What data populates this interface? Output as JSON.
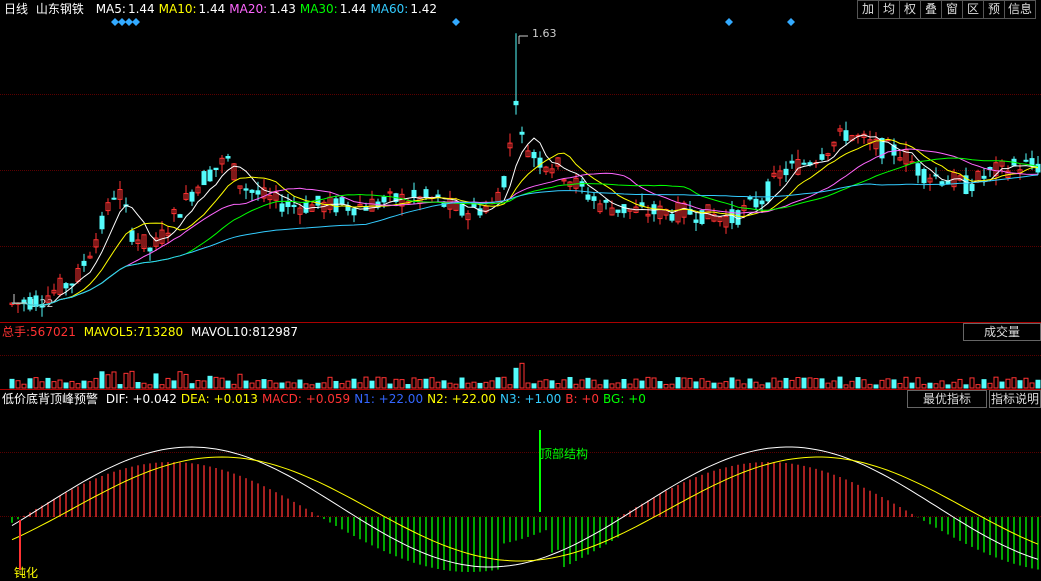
{
  "header": {
    "period": "日线",
    "stock_name": "山东钢铁",
    "ma": [
      {
        "label": "MA5:",
        "value": "1.44",
        "color": "#ffffff"
      },
      {
        "label": "MA10:",
        "value": "1.44",
        "color": "#ffff00"
      },
      {
        "label": "MA20:",
        "value": "1.43",
        "color": "#ff66ff"
      },
      {
        "label": "MA30:",
        "value": "1.44",
        "color": "#00ff00"
      },
      {
        "label": "MA60:",
        "value": "1.42",
        "color": "#33ccff"
      }
    ]
  },
  "toolbar": [
    "加",
    "均",
    "权",
    "叠",
    "窗",
    "区",
    "预",
    "信息"
  ],
  "price_chart": {
    "max_label": "1.63",
    "min_label": "1.22",
    "colors": {
      "up": "#ff3232",
      "down": "#54fcfc",
      "ma5": "#ffffff",
      "ma10": "#ffff00",
      "ma20": "#ff66ff",
      "ma30": "#00ff00",
      "ma60": "#33ccff"
    }
  },
  "volume_panel": {
    "total_label": "总手:",
    "total_value": "567021",
    "mavol5_label": "MAVOL5:",
    "mavol5_value": "713280",
    "mavol10_label": "MAVOL10:",
    "mavol10_value": "812987",
    "button": "成交量"
  },
  "indicator_panel": {
    "name": "低价底背顶峰预警",
    "params": [
      {
        "label": "DIF:",
        "value": "+0.042",
        "color": "#ffffff"
      },
      {
        "label": "DEA:",
        "value": "+0.013",
        "color": "#ffff00"
      },
      {
        "label": "MACD:",
        "value": "+0.059",
        "color": "#ff3232"
      },
      {
        "label": "N1:",
        "value": "+22.00",
        "color": "#3366ff"
      },
      {
        "label": "N2:",
        "value": "+22.00",
        "color": "#ffff00"
      },
      {
        "label": "N3:",
        "value": "+1.00",
        "color": "#33ccff"
      },
      {
        "label": "B:",
        "value": "+0",
        "color": "#ff3232"
      },
      {
        "label": "BG:",
        "value": "+0",
        "color": "#00ff00"
      }
    ],
    "annotation_top": "顶部结构",
    "annotation_bottom": "钝化",
    "btn_best": "最优指标",
    "btn_help": "指标说明"
  },
  "chart_data": {
    "type": "candlestick",
    "note_ma_values": {
      "MA5": 1.44,
      "MA10": 1.44,
      "MA20": 1.43,
      "MA30": 1.44,
      "MA60": 1.42
    },
    "visible_high": 1.63,
    "visible_low": 1.22
  }
}
